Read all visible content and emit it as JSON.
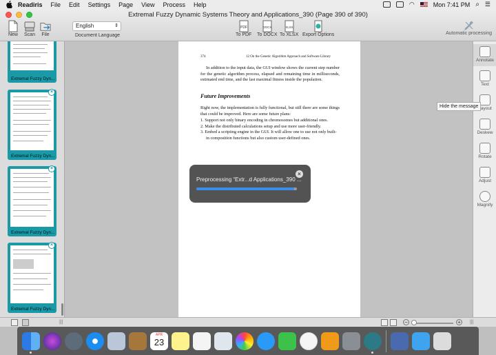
{
  "menubar": {
    "app_name": "Readiris",
    "items": [
      "File",
      "Edit",
      "Settings",
      "Page",
      "View",
      "Process",
      "Help"
    ],
    "clock": "Mon 7:41 PM"
  },
  "window": {
    "title": "Extremal Fuzzy Dynamic Systems Theory and Applications_390 (Page 390 of 390)"
  },
  "toolbar": {
    "new_label": "New",
    "scan_label": "Scan",
    "file_label": "File",
    "language_value": "English",
    "language_label": "Document Language",
    "to_pdf_label": "To PDF",
    "to_docx_label": "To DOCX",
    "to_xlsx_label": "To XLSX",
    "export_options_label": "Export Options",
    "auto_processing_label": "Automatic processing",
    "pdf_badge": "PDF",
    "docx_badge": "DOCX",
    "xlsx_badge": "XLSX"
  },
  "sidebar": {
    "thumb_caption": "Extremal Fuzzy Dyn..."
  },
  "document": {
    "page_number": "374",
    "running_head": "12   On the Genetic Algorithm Approach and Software Library",
    "para1": "In addition to the input data, the GUI window shows the current step number for the genetic algorithm process, elapsed and remaining time in milliseconds, estimated end time, and the last maximal fitness inside the population.",
    "heading": "Future Improvements",
    "para2": "Right now, the implementation is fully functional, but still there are some things that could be improved. Here are some future plans:",
    "list": [
      "1. Support not only binary encoding in chromosomes but additional ones.",
      "2. Make the distributed calculations setup and use more user-friendly.",
      "3. Embed a scripting engine in the GUI. It will allow one to use not only built-in composition functions but also custom user-defined ones."
    ]
  },
  "dialog": {
    "message": "Preprocessing “Extr...d Applications_390 ...",
    "progress": 0.97
  },
  "right_panel": {
    "annotate": "Annotate",
    "text": "Text",
    "layout": "Layout",
    "deskew": "Deskew",
    "rotate": "Rotate",
    "adjust": "Adjust",
    "magnify": "Magnify",
    "tooltip": "Hide the message"
  },
  "dock": {
    "calendar_month": "APR",
    "calendar_day": "23"
  }
}
